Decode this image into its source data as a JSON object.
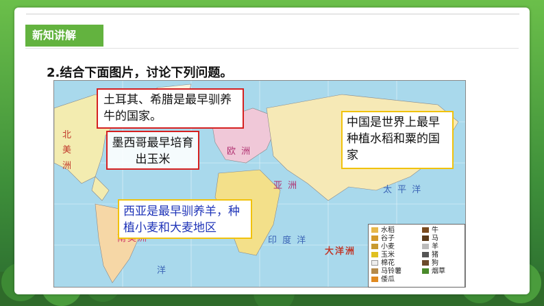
{
  "section_tag": "新知讲解",
  "question": "2.结合下面图片，讨论下列问题。",
  "map": {
    "labels": {
      "north_america": [
        "北",
        "美",
        "洲"
      ],
      "europe": "欧 洲",
      "asia": "亚 洲",
      "pacific": "太 平 洋",
      "south_america": "南美洲",
      "indian_ocean": "印 度 洋",
      "oceania": "大洋洲",
      "ocean_bottom": "洋"
    },
    "legend": [
      {
        "label": "水稻",
        "color": "#e8b84a"
      },
      {
        "label": "牛",
        "color": "#7a4a1e"
      },
      {
        "label": "谷子",
        "color": "#d49a2a"
      },
      {
        "label": "马",
        "color": "#5a3a1a"
      },
      {
        "label": "小麦",
        "color": "#c89a30"
      },
      {
        "label": "羊",
        "color": "#bbbbbb"
      },
      {
        "label": "玉米",
        "color": "#e0c020"
      },
      {
        "label": "猪",
        "color": "#555555"
      },
      {
        "label": "棉花",
        "color": "#eeeeee"
      },
      {
        "label": "狗",
        "color": "#6b4a2a"
      },
      {
        "label": "马铃薯",
        "color": "#b58a4a"
      },
      {
        "label": "烟草",
        "color": "#4a8a2a"
      },
      {
        "label": "倭瓜",
        "color": "#e08a20"
      }
    ]
  },
  "callouts": {
    "turkey_greece": "土耳其、希腊是最早驯养牛的国家。",
    "mexico": "墨西哥最早培育出玉米",
    "china": "中国是世界上最早种植水稻和粟的国家",
    "west_asia": "西亚是最早驯养羊，种植小麦和大麦地区"
  }
}
